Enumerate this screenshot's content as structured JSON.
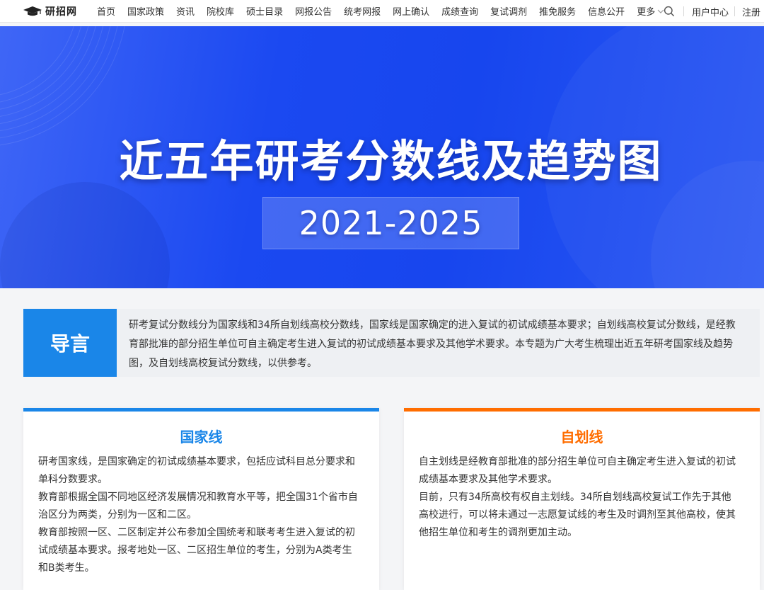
{
  "brand": {
    "name": "研招网",
    "icon": "graduation-cap-icon"
  },
  "nav": {
    "items": [
      "首页",
      "国家政策",
      "资讯",
      "院校库",
      "硕士目录",
      "网报公告",
      "统考网报",
      "网上确认",
      "成绩查询",
      "复试调剂",
      "推免服务",
      "信息公开"
    ],
    "more": "更多",
    "user_center": "用户中心",
    "register": "注册"
  },
  "banner": {
    "title": "近五年研考分数线及趋势图",
    "years": "2021-2025"
  },
  "intro": {
    "label": "导言",
    "text": "研考复试分数线分为国家线和34所自划线高校分数线，国家线是国家确定的进入复试的初试成绩基本要求；自划线高校复试分数线，是经教育部批准的部分招生单位可自主确定考生进入复试的初试成绩基本要求及其他学术要求。本专题为广大考生梳理出近五年研考国家线及趋势图，及自划线高校复试分数线，以供参考。"
  },
  "cards": {
    "national": {
      "title": "国家线",
      "paragraphs": [
        "研考国家线，是国家确定的初试成绩基本要求，包括应试科目总分要求和单科分数要求。",
        "教育部根据全国不同地区经济发展情况和教育水平等，把全国31个省市自治区分为两类，分别为一区和二区。",
        "教育部按照一区、二区制定并公布参加全国统考和联考考生进入复试的初试成绩基本要求。报考地处一区、二区招生单位的考生，分别为A类考生和B类考生。"
      ]
    },
    "self": {
      "title": "自划线",
      "paragraphs": [
        "自主划线是经教育部批准的部分招生单位可自主确定考生进入复试的初试成绩基本要求及其他学术要求。",
        "目前，只有34所高校有权自主划线。34所自划线高校复试工作先于其他高校进行，可以将未通过一志愿复试线的考生及时调剂至其他高校，使其他招生单位和考生的调剂更加主动。"
      ]
    }
  },
  "colors": {
    "accent_blue": "#1a86e8",
    "accent_orange": "#ff6d00",
    "banner_blue": "#1746ee"
  }
}
